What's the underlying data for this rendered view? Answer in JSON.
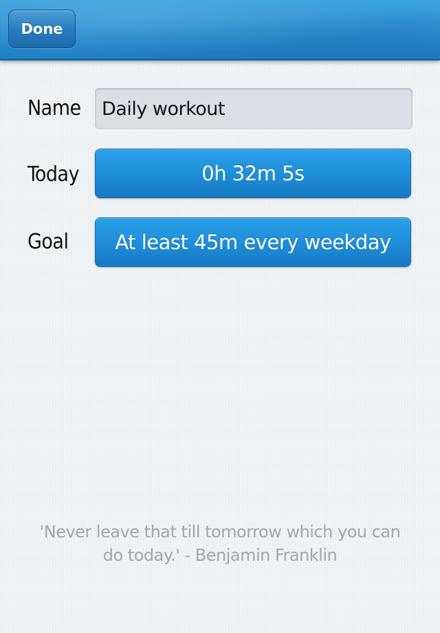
{
  "navbar": {
    "done_label": "Done"
  },
  "form": {
    "name_label": "Name",
    "name_value": "Daily workout",
    "today_label": "Today",
    "today_value": "0h 32m 5s",
    "goal_label": "Goal",
    "goal_value": "At least  45m every weekday"
  },
  "quote": {
    "line1": "'Never leave that till tomorrow which you can",
    "line2": "do today.' - Benjamin Franklin"
  },
  "colors": {
    "navbar": "#2a8fd0",
    "button": "#1f8fd9",
    "quote_text": "#a3a7ab"
  }
}
